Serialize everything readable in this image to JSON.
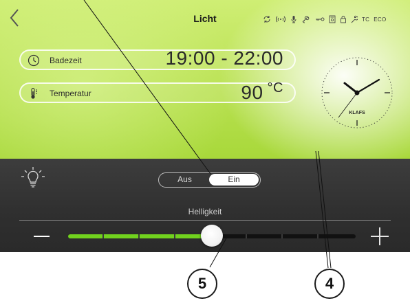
{
  "header": {
    "title": "Licht",
    "status_text": [
      "TC",
      "ECO"
    ],
    "status_icons": [
      "sync-icon",
      "wireless-icon",
      "microphone-icon",
      "fan-icon",
      "key-icon",
      "device-icon",
      "lock-icon",
      "wrench-icon"
    ]
  },
  "bathing_time": {
    "label": "Badezeit",
    "value": "19:00 - 22:00",
    "icon": "clock-icon"
  },
  "temperature": {
    "label": "Temperatur",
    "value": "90",
    "unit": "°C",
    "icon": "thermometer-icon"
  },
  "clock": {
    "brand": "KLAFS"
  },
  "light": {
    "toggle_off": "Aus",
    "toggle_on": "Ein",
    "selected": "Ein",
    "brightness_label": "Helligkeit",
    "brightness_fraction": 0.5
  },
  "callouts": {
    "left": "5",
    "right": "4"
  },
  "colors": {
    "accent_green": "#71d21e",
    "panel_green": "#b9e152",
    "dark_panel": "#2f2f2f"
  }
}
